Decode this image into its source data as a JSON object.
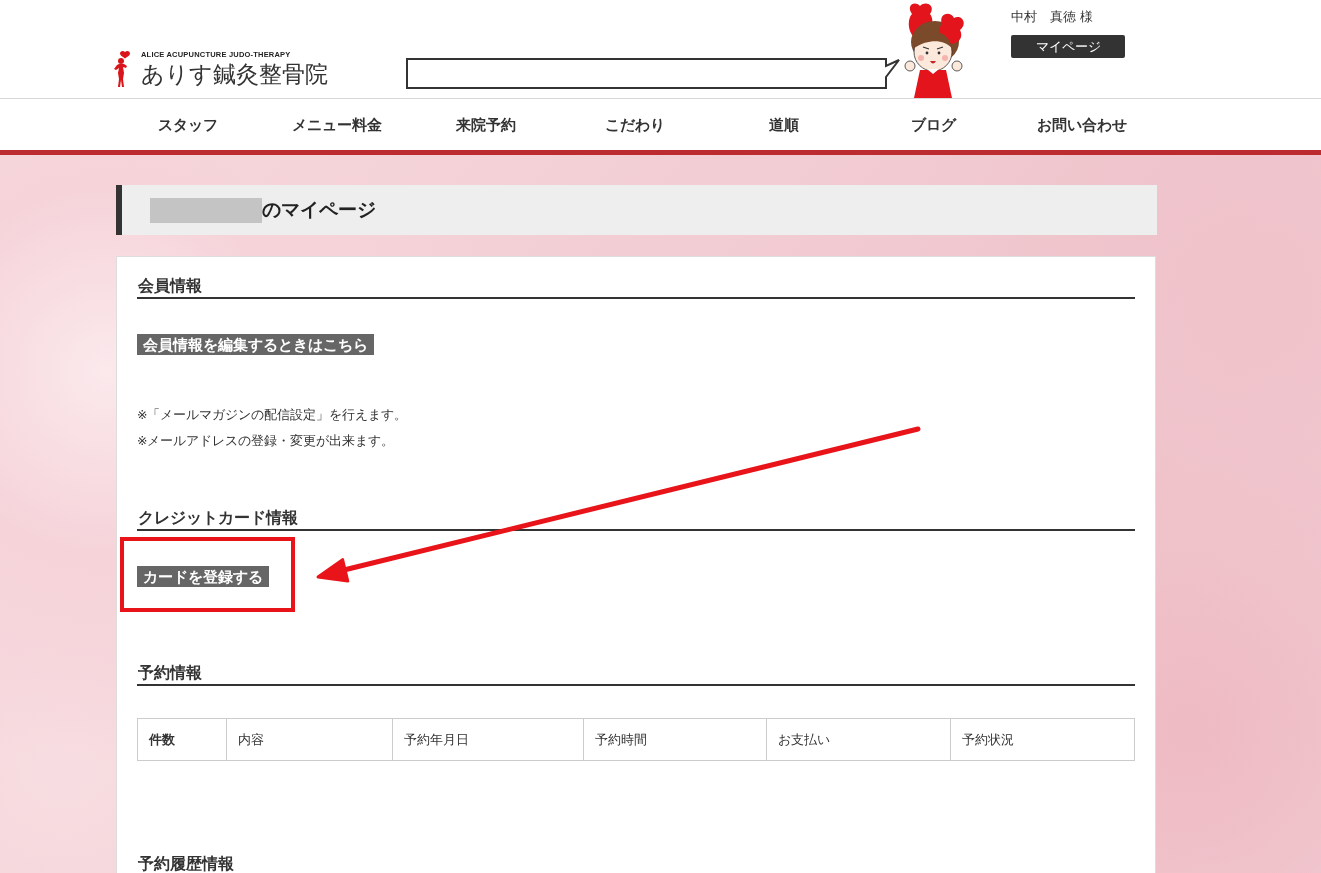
{
  "header": {
    "logo": {
      "tagline": "ALICE ACUPUNCTURE JUDO-THERAPY",
      "name": "ありす鍼灸整骨院"
    },
    "user_name": "中村　真徳 様",
    "mypage_button": "マイページ"
  },
  "nav": [
    "スタッフ",
    "メニュー料金",
    "来院予約",
    "こだわり",
    "道順",
    "ブログ",
    "お問い合わせ"
  ],
  "page_title": {
    "text": "のマイページ",
    "redacted": true
  },
  "sections": [
    {
      "heading": "会員情報",
      "items": [
        {
          "kind": "button",
          "label": "会員情報を編集するときはこちら",
          "highlighted": false
        },
        {
          "kind": "notes",
          "lines": [
            "※「メールマガジンの配信設定」を行えます。",
            "※メールアドレスの登録・変更が出来ます。"
          ]
        }
      ]
    },
    {
      "heading": "クレジットカード情報",
      "items": [
        {
          "kind": "button",
          "label": "カードを登録する",
          "highlighted": true
        }
      ]
    },
    {
      "heading": "予約情報",
      "items": [
        {
          "kind": "table",
          "columns": [
            "件数",
            "内容",
            "予約年月日",
            "予約時間",
            "お支払い",
            "予約状況"
          ]
        }
      ]
    },
    {
      "heading": "予約履歴情報"
    }
  ]
}
